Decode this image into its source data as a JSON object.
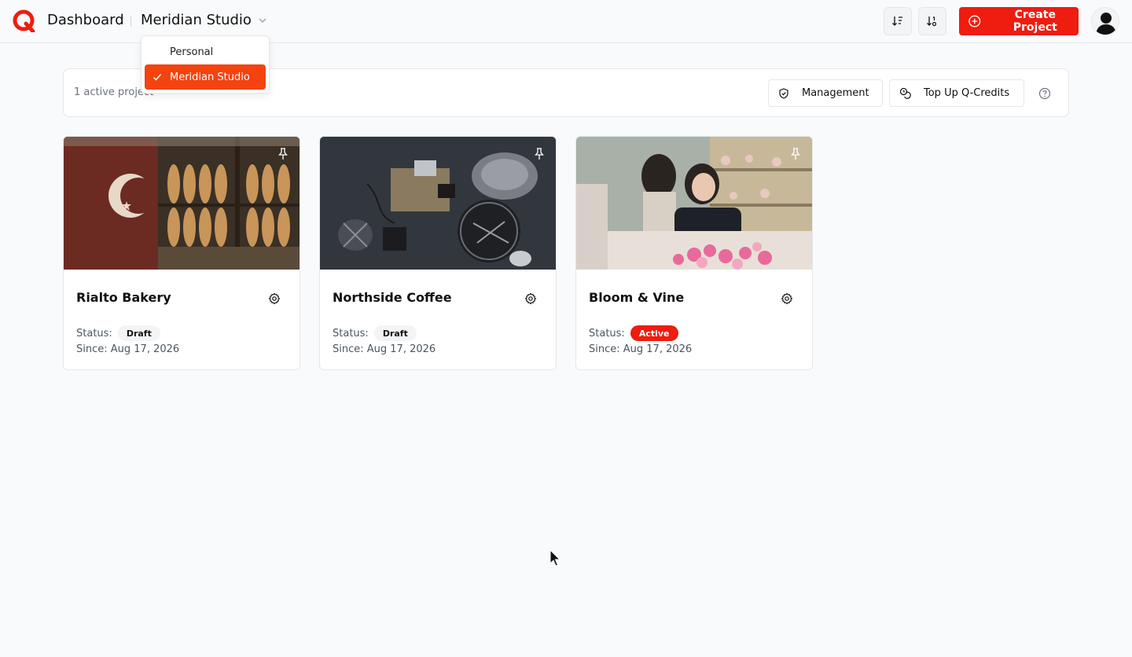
{
  "header": {
    "title": "Dashboard",
    "workspace": "Meridian Studio",
    "create_label": "Create Project",
    "sort_icons": [
      "sort-ascending-icon",
      "sort-descending-icon"
    ]
  },
  "workspace_menu": {
    "items": [
      {
        "label": "Personal",
        "selected": false
      },
      {
        "label": "Meridian Studio",
        "selected": true
      }
    ]
  },
  "toolbar": {
    "count_label": "1 active project",
    "management_label": "Management",
    "topup_label": "Top Up Q-Credits"
  },
  "projects": [
    {
      "name": "Rialto Bakery",
      "status_prefix": "Status:",
      "status": "Draft",
      "since": "Since: Aug 17, 2026"
    },
    {
      "name": "Northside Coffee",
      "status_prefix": "Status:",
      "status": "Draft",
      "since": "Since: Aug 17, 2026"
    },
    {
      "name": "Bloom & Vine",
      "status_prefix": "Status:",
      "status": "Active",
      "since": "Since: Aug 17, 2026"
    }
  ],
  "colors": {
    "brand": "#ef1c10",
    "menu_active": "#f4430f",
    "background": "#f9fafb"
  }
}
